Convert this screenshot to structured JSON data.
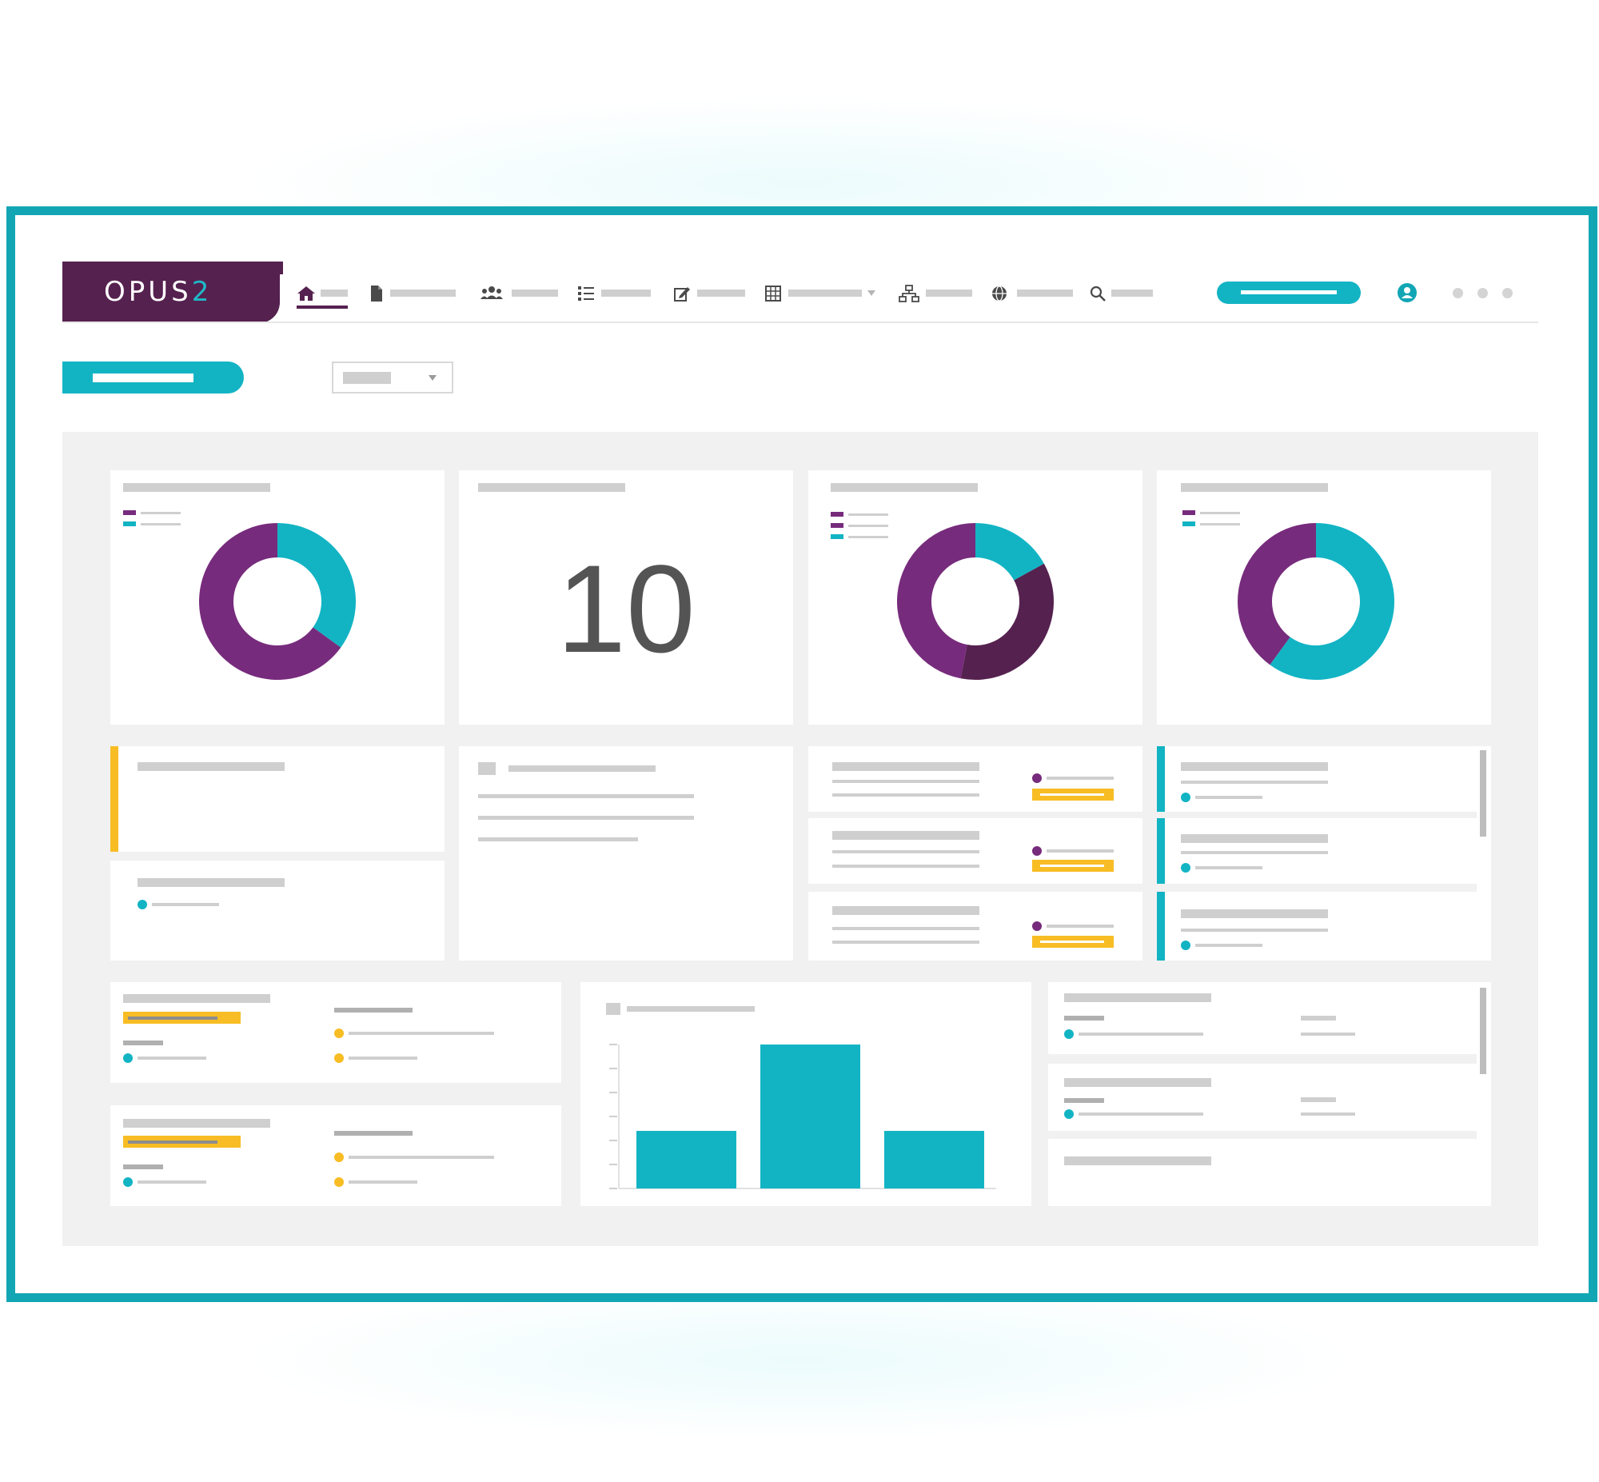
{
  "app": {
    "logo_text": "OPUS",
    "logo_suffix": "2"
  },
  "nav": {
    "items": [
      {
        "icon": "home-icon",
        "active": true
      },
      {
        "icon": "document-icon"
      },
      {
        "icon": "people-icon"
      },
      {
        "icon": "list-icon"
      },
      {
        "icon": "edit-icon"
      },
      {
        "icon": "grid-icon",
        "dropdown": true
      },
      {
        "icon": "hierarchy-icon"
      },
      {
        "icon": "globe-icon"
      },
      {
        "icon": "search-icon"
      }
    ]
  },
  "kpi": {
    "value": "10"
  },
  "colors": {
    "frame": "#12a6b5",
    "brand_purple": "#55214f",
    "purple": "#772b7c",
    "teal": "#12b4c4",
    "yellow": "#f8bd24",
    "panel_bg": "#f1f1f1"
  },
  "chart_data": [
    {
      "type": "pie",
      "variant": "donut",
      "values": [
        35,
        65
      ],
      "colors": [
        "#12b4c4",
        "#772b7c"
      ]
    },
    {
      "type": "pie",
      "variant": "donut",
      "values": [
        17,
        36,
        47
      ],
      "colors": [
        "#12b4c4",
        "#55214f",
        "#772b7c"
      ]
    },
    {
      "type": "pie",
      "variant": "donut",
      "values": [
        60,
        40
      ],
      "colors": [
        "#12b4c4",
        "#772b7c"
      ]
    },
    {
      "type": "bar",
      "values": [
        40,
        100,
        40
      ],
      "ylim": [
        0,
        100
      ],
      "color": "#12b4c4"
    }
  ]
}
